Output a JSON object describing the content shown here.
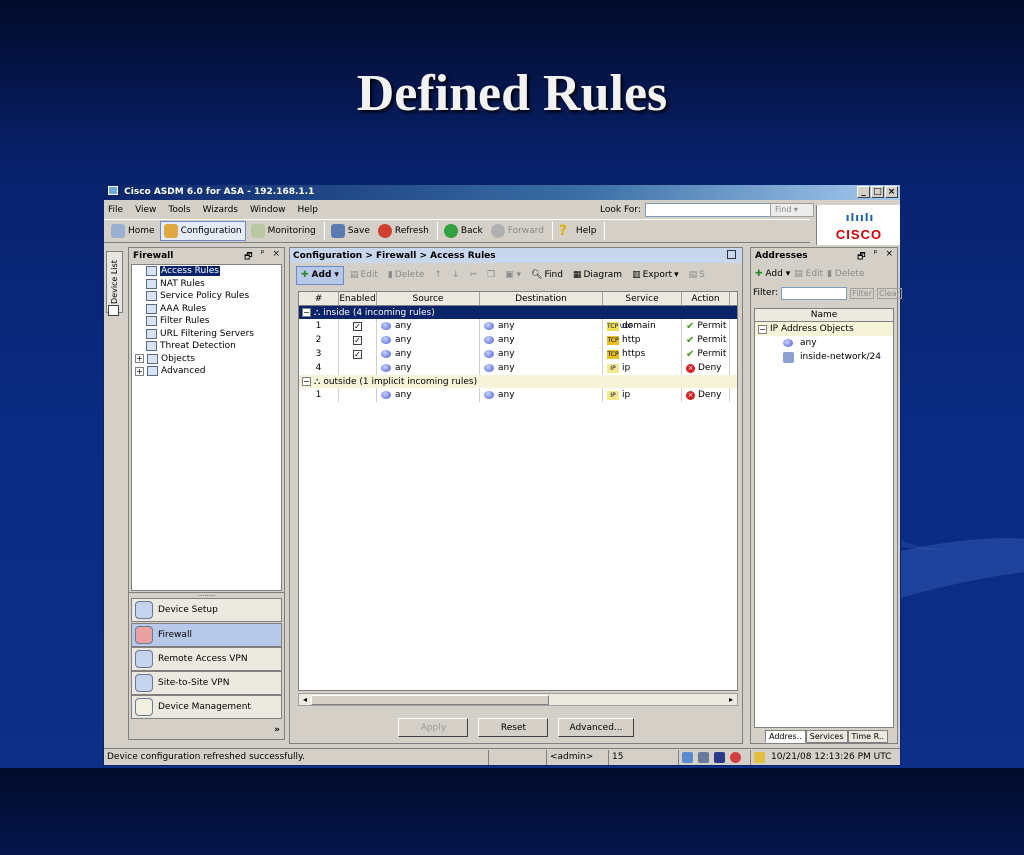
{
  "slide": {
    "title": "Defined Rules"
  },
  "window": {
    "title": "Cisco ASDM 6.0 for ASA - 192.168.1.1",
    "buttons": {
      "minimize": "_",
      "maximize": "□",
      "close": "×"
    }
  },
  "menu": [
    "File",
    "View",
    "Tools",
    "Wizards",
    "Window",
    "Help"
  ],
  "search": {
    "label": "Look For:",
    "value": "",
    "find_label": "Find ▾"
  },
  "toolbar": {
    "home": "Home",
    "configuration": "Configuration",
    "monitoring": "Monitoring",
    "save": "Save",
    "refresh": "Refresh",
    "back": "Back",
    "forward": "Forward",
    "help": "Help"
  },
  "brand": {
    "bars": "ılıılı",
    "word": "CISCO"
  },
  "side_tab": "Device List",
  "left_panel": {
    "title": "Firewall",
    "controls": [
      "🗗",
      "ᵖ",
      "×"
    ],
    "tree": [
      {
        "label": "Access Rules",
        "selected": true
      },
      {
        "label": "NAT Rules"
      },
      {
        "label": "Service Policy Rules"
      },
      {
        "label": "AAA Rules"
      },
      {
        "label": "Filter Rules"
      },
      {
        "label": "URL Filtering Servers"
      },
      {
        "label": "Threat Detection"
      },
      {
        "label": "Objects",
        "expandable": true
      },
      {
        "label": "Advanced",
        "expandable": true
      }
    ],
    "grip": "........",
    "nav": [
      "Device Setup",
      "Firewall",
      "Remote Access VPN",
      "Site-to-Site VPN",
      "Device Management"
    ],
    "more": "»"
  },
  "center": {
    "breadcrumb": "Configuration > Firewall > Access Rules",
    "tools": {
      "add": "Add",
      "edit": "Edit",
      "delete": "Delete",
      "find": "Find",
      "diagram": "Diagram",
      "export": "Export",
      "s": "S"
    },
    "columns": [
      "#",
      "Enabled",
      "Source",
      "Destination",
      "Service",
      "Action"
    ],
    "groups": [
      {
        "label": "inside (4 incoming rules)",
        "selected": true,
        "rows": [
          {
            "num": "1",
            "enabled": true,
            "source": "any",
            "destination": "any",
            "service": "domain",
            "svc_badge": "TCP UDP",
            "action": "Permit"
          },
          {
            "num": "2",
            "enabled": true,
            "source": "any",
            "destination": "any",
            "service": "http",
            "svc_badge": "TCP",
            "action": "Permit"
          },
          {
            "num": "3",
            "enabled": true,
            "source": "any",
            "destination": "any",
            "service": "https",
            "svc_badge": "TCP",
            "action": "Permit"
          },
          {
            "num": "4",
            "enabled": false,
            "source": "any",
            "destination": "any",
            "service": "ip",
            "svc_badge": "IP",
            "action": "Deny"
          }
        ]
      },
      {
        "label": "outside (1 implicit incoming rules)",
        "selected": false,
        "rows": [
          {
            "num": "1",
            "enabled": false,
            "source": "any",
            "destination": "any",
            "service": "ip",
            "svc_badge": "IP",
            "action": "Deny"
          }
        ]
      }
    ],
    "buttons": {
      "apply": "Apply",
      "reset": "Reset",
      "advanced": "Advanced..."
    }
  },
  "right_panel": {
    "title": "Addresses",
    "tools": {
      "add": "Add",
      "edit": "Edit",
      "delete": "Delete"
    },
    "filter": {
      "label": "Filter:",
      "value": "",
      "filter_btn": "Filter",
      "clear_btn": "Clear"
    },
    "column": "Name",
    "items": [
      {
        "label": "IP Address Objects",
        "group": true
      },
      {
        "label": "any"
      },
      {
        "label": "inside-network/24"
      }
    ],
    "tabs": [
      "Addres..",
      "Services",
      "Time R.."
    ]
  },
  "status": {
    "message": "Device configuration refreshed successfully.",
    "user": "<admin>",
    "level": "15",
    "datetime": "10/21/08 12:13:26 PM UTC"
  },
  "colors": {
    "accent": "#0a246a",
    "permit": "#3a9a1a",
    "deny": "#d02020"
  }
}
